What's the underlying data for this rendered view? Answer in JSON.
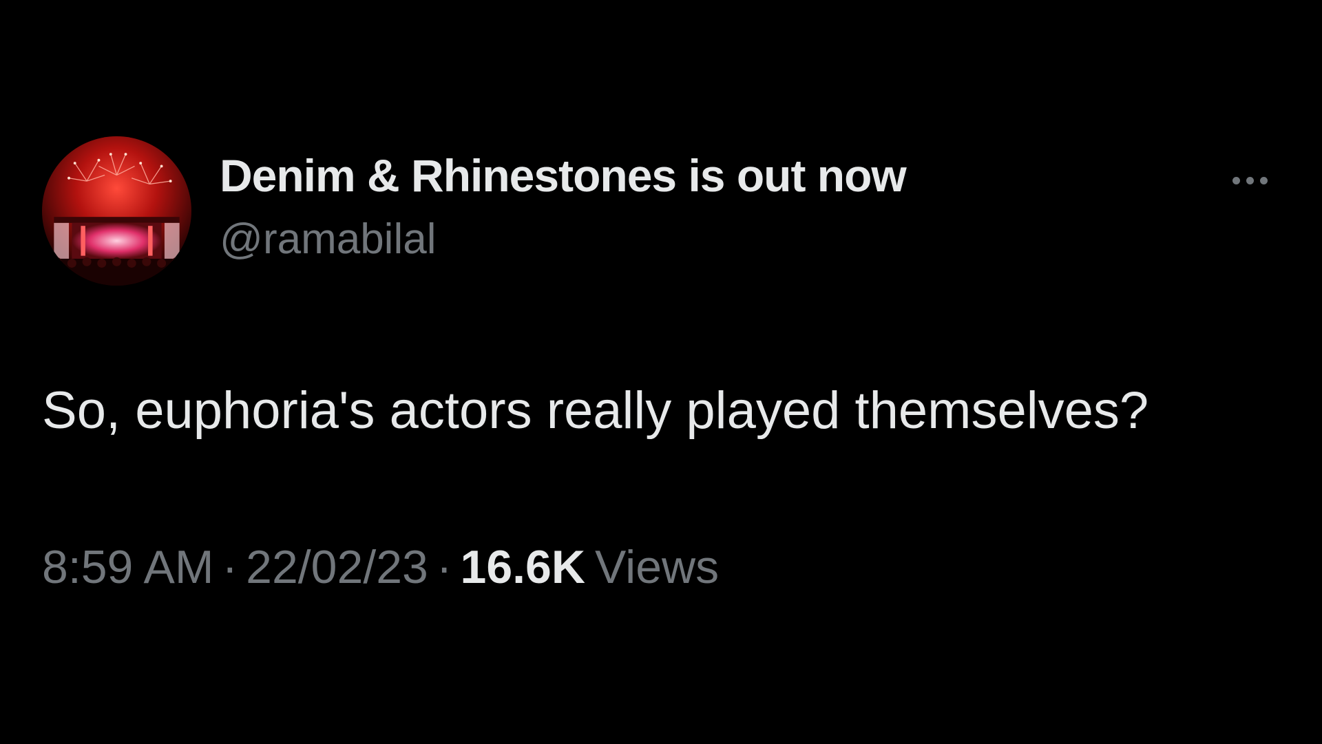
{
  "tweet": {
    "author": {
      "display_name": "Denim & Rhinestones is out now",
      "handle": "@ramabilal",
      "avatar_icon": "concert-stage-fireworks-avatar"
    },
    "more_icon": "more-horizontal-icon",
    "text": "So, euphoria's actors really played themselves?",
    "meta": {
      "time": "8:59 AM",
      "separator": "·",
      "date": "22/02/23",
      "views_count": "16.6K",
      "views_label": "Views"
    }
  },
  "colors": {
    "background": "#000000",
    "primary_text": "#e7e9ea",
    "secondary_text": "#71767b",
    "avatar_accent": "#d8201c"
  }
}
